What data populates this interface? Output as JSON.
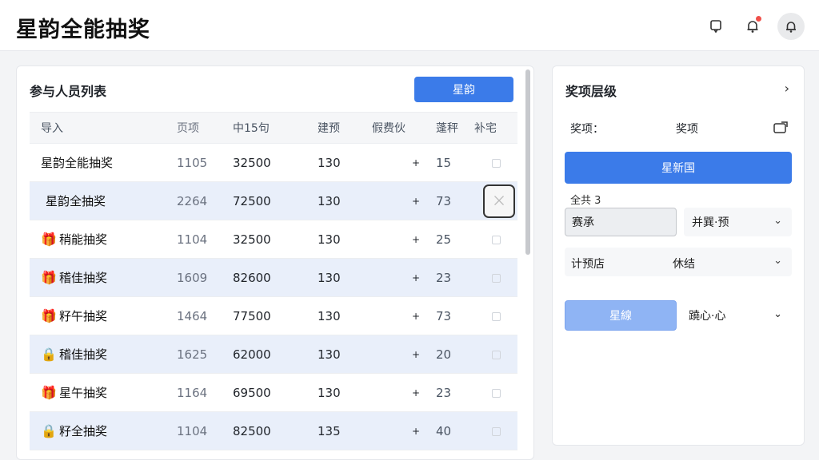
{
  "header": {
    "app_title": "星韵全能抽奖",
    "notify_dot": true
  },
  "participants": {
    "title": "参与人员列表",
    "primary_button": "星韵",
    "columns": [
      "导入",
      "页项",
      "中15句",
      "建预",
      "假费伙",
      "蓬秤",
      "补宅"
    ],
    "rows": [
      {
        "name": "星韵全能抽奖",
        "icon": "",
        "c1": "1105",
        "c2": "32500",
        "c3": "130",
        "c4": "+",
        "c5": "15",
        "checked": false
      },
      {
        "name": "星韵全抽奖",
        "icon": "",
        "c1": "2264",
        "c2": "72500",
        "c3": "130",
        "c4": "+",
        "c5": "73",
        "checked": true
      },
      {
        "name": "稍能抽奖",
        "icon": "gift-icon",
        "c1": "1104",
        "c2": "32500",
        "c3": "130",
        "c4": "+",
        "c5": "25",
        "checked": false
      },
      {
        "name": "稽佳抽奖",
        "icon": "gift-icon",
        "c1": "1609",
        "c2": "82600",
        "c3": "130",
        "c4": "+",
        "c5": "23",
        "checked": false
      },
      {
        "name": "籽午抽奖",
        "icon": "gift-icon",
        "c1": "1464",
        "c2": "77500",
        "c3": "130",
        "c4": "+",
        "c5": "73",
        "checked": false
      },
      {
        "name": "稽佳抽奖",
        "icon": "lock-icon",
        "c1": "1625",
        "c2": "62000",
        "c3": "130",
        "c4": "+",
        "c5": "20",
        "checked": false
      },
      {
        "name": "星午抽奖",
        "icon": "gift-icon",
        "c1": "1164",
        "c2": "69500",
        "c3": "130",
        "c4": "+",
        "c5": "23",
        "checked": false
      },
      {
        "name": "籽全抽奖",
        "icon": "lock-icon",
        "c1": "1104",
        "c2": "82500",
        "c3": "135",
        "c4": "+",
        "c5": "40",
        "checked": false
      }
    ]
  },
  "prize_panel": {
    "title": "奖项层级",
    "prize_label": "奖项：",
    "prize_value": "奖项",
    "main_button": "星新国",
    "field_label": "全共 3",
    "input_value": "赛承",
    "select_a": "并巽·预",
    "select_b_label": "计预店",
    "select_b_value": "休结",
    "light_button": "星線",
    "inline_select": "蹺心·心"
  },
  "colors": {
    "primary": "#3b7be9",
    "primary_light": "#8fb4f4",
    "row_alt": "#e9effa",
    "badge": "#f0504a"
  }
}
